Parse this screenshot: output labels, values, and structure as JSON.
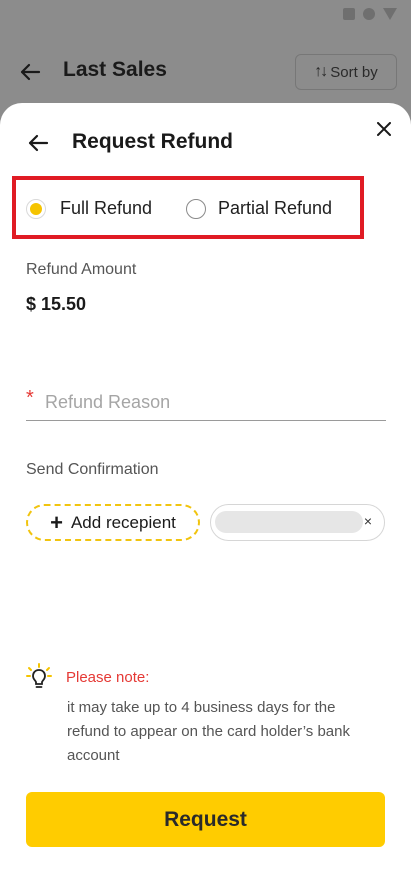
{
  "background": {
    "title": "Last Sales",
    "sort_label": "Sort by"
  },
  "sheet": {
    "title": "Request Refund",
    "refund_options": [
      {
        "label": "Full Refund",
        "selected": true
      },
      {
        "label": "Partial Refund",
        "selected": false
      }
    ],
    "amount_label": "Refund Amount",
    "amount_value": "$ 15.50",
    "reason_required_mark": "*",
    "reason_placeholder": "Refund Reason",
    "confirmation_label": "Send Confirmation",
    "add_recipient_label": "Add recepient",
    "chip_remove": "×",
    "note_title": "Please note:",
    "note_body": "it may take up to 4 business days for the refund to appear on the card holder’s bank account",
    "request_label": "Request"
  },
  "colors": {
    "accent": "#ffcc00",
    "highlight_box": "#e01b24",
    "note_title": "#e53935"
  }
}
